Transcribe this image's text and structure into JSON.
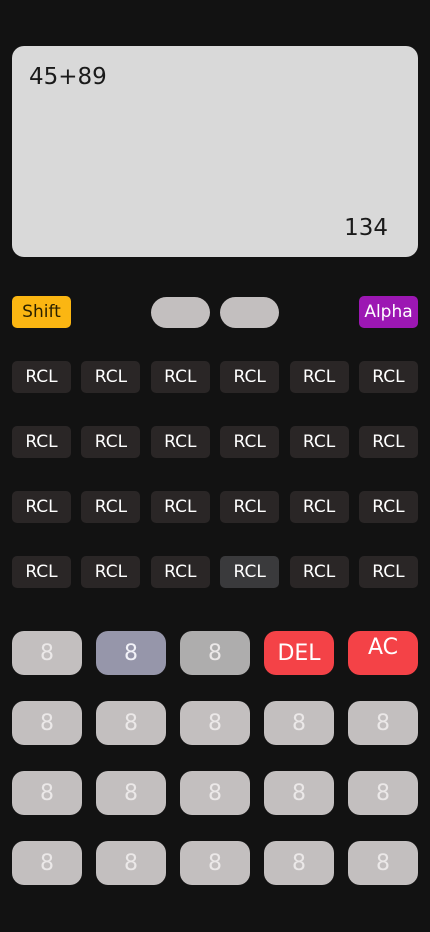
{
  "display": {
    "expression": "45+89",
    "result": "134"
  },
  "mode_row": {
    "shift_label": "Shift",
    "alpha_label": "Alpha",
    "colors": {
      "shift": "#fbb612",
      "alpha": "#9c17b3",
      "pill": "#c3bfbf"
    }
  },
  "rcl_rows": [
    [
      "RCL",
      "RCL",
      "RCL",
      "RCL",
      "RCL",
      "RCL"
    ],
    [
      "RCL",
      "RCL",
      "RCL",
      "RCL",
      "RCL",
      "RCL"
    ],
    [
      "RCL",
      "RCL",
      "RCL",
      "RCL",
      "RCL",
      "RCL"
    ],
    [
      "RCL",
      "RCL",
      "RCL",
      "RCL",
      "RCL",
      "RCL"
    ]
  ],
  "keypad_rows": [
    [
      "8",
      "8",
      "8",
      "DEL",
      "AC"
    ],
    [
      "8",
      "8",
      "8",
      "8",
      "8"
    ],
    [
      "8",
      "8",
      "8",
      "8",
      "8"
    ],
    [
      "8",
      "8",
      "8",
      "8",
      "8"
    ]
  ],
  "colors": {
    "background": "#121212",
    "display_bg": "#d9d9d9",
    "rcl_bg": "#2a2626",
    "key_bg": "#c3bfbf",
    "key_blue": "#9696aa",
    "key_gray": "#aeadad",
    "key_red": "#f44247"
  }
}
